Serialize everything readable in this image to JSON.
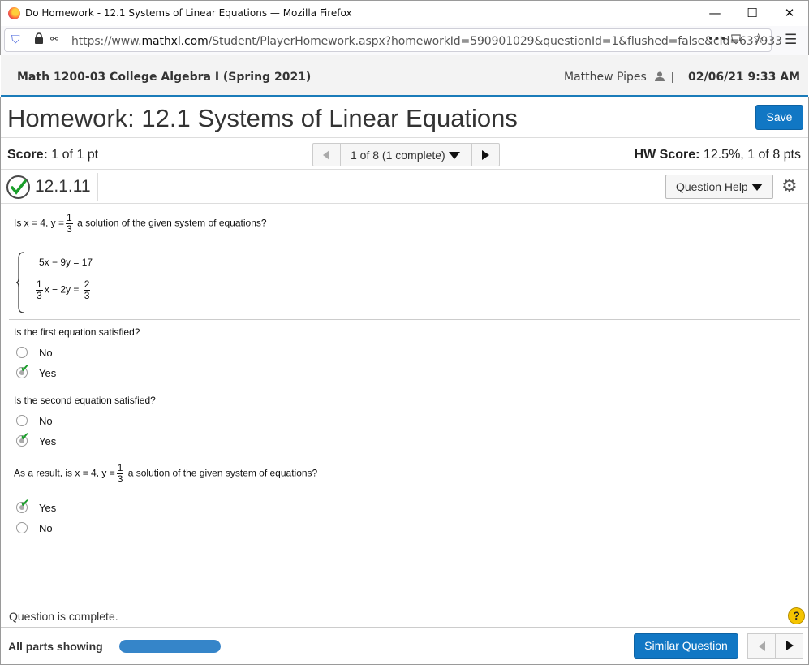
{
  "window": {
    "title": "Do Homework - 12.1 Systems of Linear Equations — Mozilla Firefox",
    "minimize": "—",
    "maximize": "☐",
    "close": "✕"
  },
  "browser": {
    "url_prefix": "https://www.",
    "url_domain": "mathxl.com",
    "url_rest": "/Student/PlayerHomework.aspx?homeworkId=590901029&questionId=1&flushed=false&cId=637933",
    "more": "•••",
    "pocket": "⛉",
    "star": "☆",
    "menu": "☰",
    "shield": "⛉",
    "lock": "🔒",
    "perm": "⚯"
  },
  "course": {
    "name": "Math 1200-03 College Algebra I (Spring 2021)",
    "user": "Matthew Pipes",
    "user_icon": "person-icon",
    "separator": "|",
    "datetime": "02/06/21 9:33 AM"
  },
  "homework": {
    "title": "Homework: 12.1 Systems of Linear Equations",
    "save_label": "Save",
    "score_label": "Score:",
    "score_value": "1 of 1 pt",
    "question_nav": "1 of 8 (1 complete)",
    "hw_score_label": "HW Score:",
    "hw_score_value": "12.5%, 1 of 8 pts"
  },
  "question": {
    "number": "12.1.11",
    "help_label": "Question Help",
    "prompt_pre": "Is x = 4, y =",
    "prompt_num": "1",
    "prompt_den": "3",
    "prompt_post": "a solution of the given system of equations?",
    "eq1": "5x − 9y = 17",
    "eq2_num": "1",
    "eq2_den": "3",
    "eq2_mid": "x − 2y =",
    "eq2_rnum": "2",
    "eq2_rden": "3",
    "part1": {
      "prompt": "Is the first equation satisfied?",
      "options": [
        "No",
        "Yes"
      ],
      "selected": "Yes"
    },
    "part2": {
      "prompt": "Is the second equation satisfied?",
      "options": [
        "No",
        "Yes"
      ],
      "selected": "Yes"
    },
    "part3": {
      "prompt_pre": "As a result, is x = 4, y =",
      "prompt_num": "1",
      "prompt_den": "3",
      "prompt_post": "a solution of the given system of equations?",
      "options": [
        "Yes",
        "No"
      ],
      "selected": "Yes"
    },
    "status": "Question is complete.",
    "help_icon": "?"
  },
  "footer": {
    "all_parts": "All parts showing",
    "progress_fraction": 1.0,
    "similar_label": "Similar Question"
  },
  "colors": {
    "accent": "#1177c4",
    "check": "#1a9e2a",
    "course_border": "#1a7bb9"
  }
}
